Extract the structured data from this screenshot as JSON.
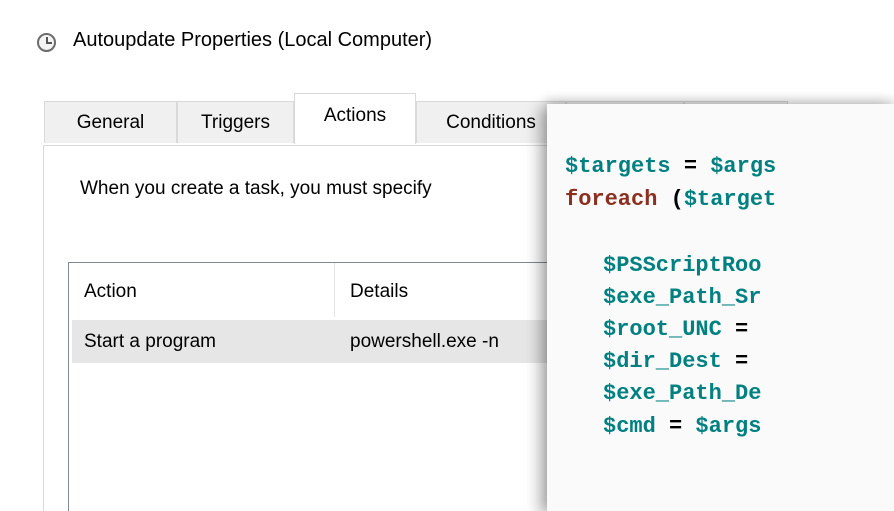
{
  "window": {
    "title": "Autoupdate Properties (Local Computer)",
    "icon": "clock-icon"
  },
  "tabs": [
    {
      "label": "General"
    },
    {
      "label": "Triggers"
    },
    {
      "label": "Actions",
      "active": true
    },
    {
      "label": "Conditions"
    },
    {
      "label": "",
      "note": "hidden"
    },
    {
      "label": ""
    }
  ],
  "actions_tab": {
    "instruction": "When you create a task, you must specify",
    "table": {
      "columns": [
        "Action",
        "Details"
      ],
      "rows": [
        {
          "action": "Start a program",
          "details": "powershell.exe -n"
        }
      ]
    }
  },
  "code_overlay": {
    "lines": [
      {
        "var": "$targets",
        "op": " = ",
        "rest": "$args"
      },
      {
        "kw": "foreach",
        "rest": " (",
        "var": "$target"
      },
      {
        "var": "$PSScriptRoo"
      },
      {
        "var": "$exe_Path_Sr"
      },
      {
        "var": "$root_UNC",
        "op": " ="
      },
      {
        "var": "$dir_Dest",
        "op": " ="
      },
      {
        "var": "$exe_Path_De"
      },
      {
        "var": "$cmd",
        "op": " = ",
        "rest": "$args"
      }
    ]
  },
  "colors": {
    "variable": "#008080",
    "keyword": "#8b2f1f",
    "selected_row": "#e6e6e6"
  }
}
